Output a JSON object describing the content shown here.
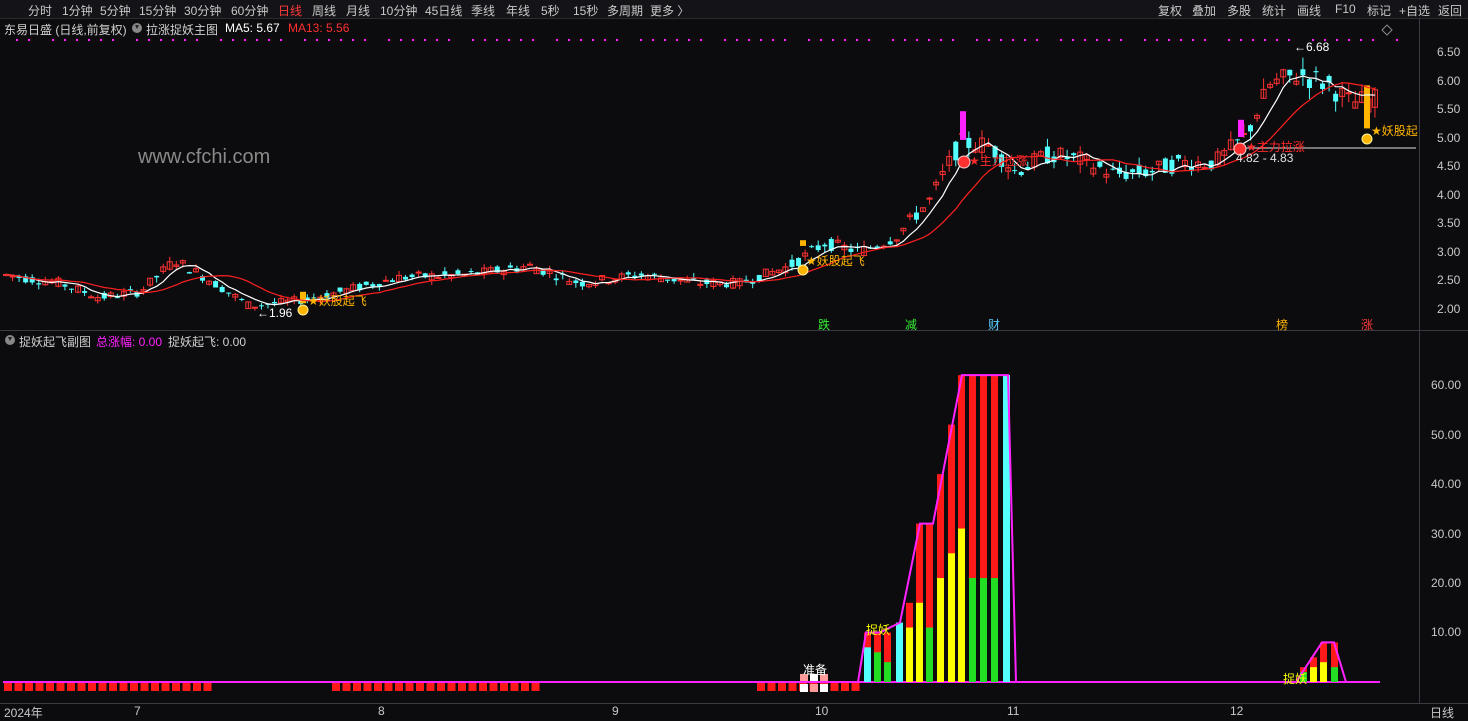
{
  "toolbar": {
    "tabs": [
      "分时",
      "1分钟",
      "5分钟",
      "15分钟",
      "30分钟",
      "60分钟",
      "日线",
      "周线",
      "月线",
      "10分钟",
      "45日线",
      "季线",
      "年线",
      "5秒",
      "15秒",
      "多周期",
      "更多 〉"
    ],
    "active": "日线",
    "right_tabs": [
      "复权",
      "叠加",
      "多股",
      "统计",
      "画线",
      "F10",
      "标记",
      "+自选",
      "返回"
    ]
  },
  "main_header": {
    "stock": "东易日盛 (日线,前复权)",
    "indicator": "拉涨捉妖主图",
    "ma5": "MA5: 5.67",
    "ma13": "MA13: 5.56"
  },
  "sub_header": {
    "indicator": "捉妖起飞副图",
    "total": "总涨幅: 0.00",
    "fly": "捉妖起飞: 0.00"
  },
  "watermark": "www.cfchi.com",
  "price_axis": [
    "6.50",
    "6.00",
    "5.50",
    "5.00",
    "4.50",
    "4.00",
    "3.50",
    "3.00",
    "2.50",
    "2.00"
  ],
  "sub_axis": [
    "60.00",
    "50.00",
    "40.00",
    "30.00",
    "20.00",
    "10.00"
  ],
  "x_axis": [
    "2024年",
    "7",
    "8",
    "9",
    "10",
    "11",
    "12",
    "日线"
  ],
  "annotations": {
    "low": "1.96",
    "high": "6.68",
    "fly1": "★妖股起飞",
    "fly2": "★妖股起飞",
    "fly3": "★妖股起",
    "force1": "★主力拉涨",
    "force2": "★主力拉涨",
    "range": "4.82 - 4.83",
    "prep": "准备",
    "catch1": "捉妖",
    "catch2": "捉妖"
  },
  "events": [
    "跌",
    "减",
    "财",
    "榜",
    "涨"
  ],
  "colors": {
    "up": "#ff3232",
    "down": "#54ffff",
    "ma5": "#ffffff",
    "ma13": "#ff2020",
    "total": "#ff22ff",
    "yellow": "#ffff00",
    "green": "#22dd22",
    "orange": "#ffb400"
  }
}
